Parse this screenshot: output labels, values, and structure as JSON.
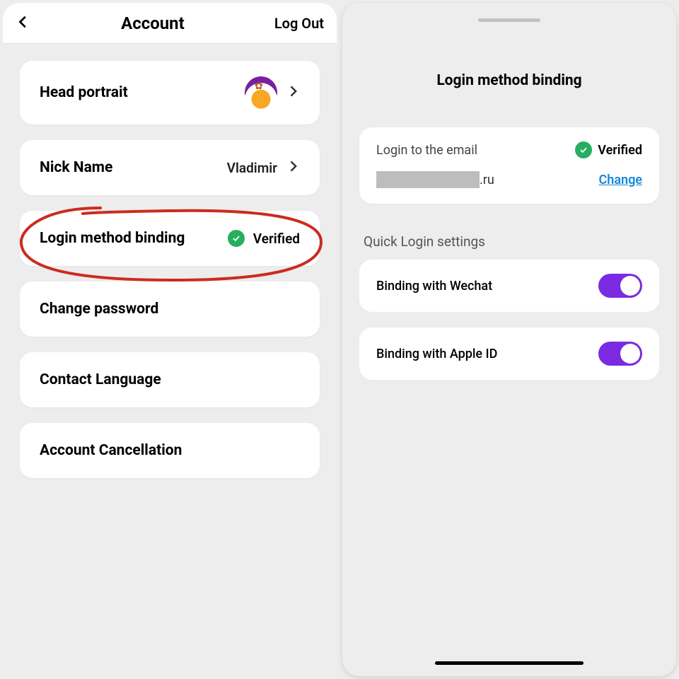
{
  "left": {
    "header": {
      "title": "Account",
      "logout": "Log Out"
    },
    "rows": {
      "head_portrait": "Head portrait",
      "nick_name": {
        "label": "Nick Name",
        "value": "Vladimir"
      },
      "login_binding": {
        "label": "Login method binding",
        "status": "Verified"
      },
      "change_password": "Change password",
      "contact_language": "Contact Language",
      "cancellation": "Account Cancellation"
    }
  },
  "right": {
    "title": "Login method binding",
    "email": {
      "label": "Login to the email",
      "status": "Verified",
      "domain": ".ru",
      "change": "Change"
    },
    "quick_login_title": "Quick Login settings",
    "toggles": {
      "wechat": {
        "label": "Binding with Wechat",
        "on": true
      },
      "apple": {
        "label": "Binding with Apple ID",
        "on": true
      }
    }
  }
}
